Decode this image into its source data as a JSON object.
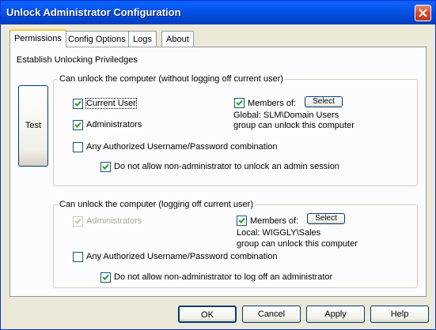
{
  "window": {
    "title": "Unlock Administrator Configuration"
  },
  "tabs": [
    {
      "label": "Permissions",
      "active": true
    },
    {
      "label": "Config Options",
      "active": false
    },
    {
      "label": "Logs",
      "active": false
    },
    {
      "label": "About",
      "active": false
    }
  ],
  "permissions": {
    "section_label": "Establish Unlocking Priviledges",
    "test_button": "Test",
    "group1": {
      "title": "Can unlock the computer (without logging off current user)",
      "current_user": {
        "label": "Current User",
        "checked": true
      },
      "administrators": {
        "label": "Administrators",
        "checked": true
      },
      "any_authorized": {
        "label": "Any Authorized Username/Password combination",
        "checked": false
      },
      "no_non_admin": {
        "label": "Do not allow non-administrator to unlock an admin session",
        "checked": true
      },
      "members_of": {
        "label": "Members of:",
        "checked": true
      },
      "select_button": "Select",
      "group_info_line1": "Global: SLM\\Domain Users",
      "group_info_line2": "group can unlock this computer"
    },
    "group2": {
      "title": "Can unlock the computer (logging off current user)",
      "administrators": {
        "label": "Administrators",
        "checked": true,
        "disabled": true
      },
      "any_authorized": {
        "label": "Any Authorized Username/Password combination",
        "checked": false
      },
      "no_non_admin": {
        "label": "Do not allow non-administrator to log off an administrator",
        "checked": true
      },
      "members_of": {
        "label": "Members of:",
        "checked": true
      },
      "select_button": "Select",
      "group_info_line1": "Local: WIGGLY\\Sales",
      "group_info_line2": "group can unlock this computer"
    }
  },
  "footer": {
    "ok": "OK",
    "cancel": "Cancel",
    "apply": "Apply",
    "help": "Help"
  }
}
